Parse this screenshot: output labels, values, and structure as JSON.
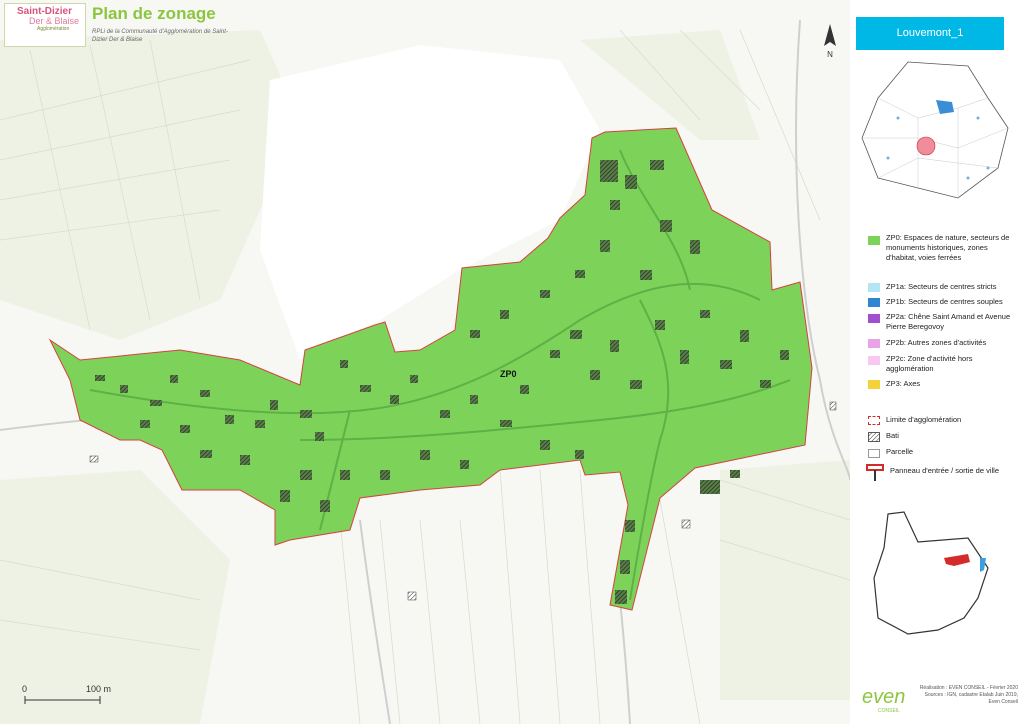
{
  "header": {
    "logo_line1": "Saint-Dizier",
    "logo_line2": "Der & Blaise",
    "logo_line3": "Agglomération",
    "title": "Plan de zonage",
    "subtitle": "RPLi de la Communauté d'Agglomération de Saint-Dizier Der & Blaise"
  },
  "map": {
    "zone_label": "ZP0",
    "north_label": "N"
  },
  "panel": {
    "commune": "Louvemont_1"
  },
  "legend": {
    "items": [
      {
        "label": "ZP0: Espaces de nature, secteurs de monuments historiques, zones d'habitat, voies ferrées",
        "color": "#7dd35a"
      },
      {
        "label": "ZP1a: Secteurs de centres stricts",
        "color": "#b3e6f5"
      },
      {
        "label": "ZP1b: Secteurs de centres souples",
        "color": "#2e86d1"
      },
      {
        "label": "ZP2a: Chêne Saint Amand et Avenue Pierre Beregovoy",
        "color": "#a14fd0"
      },
      {
        "label": "ZP2b: Autres zones d'activités",
        "color": "#e9a3e8"
      },
      {
        "label": "ZP2c: Zone d'activité hors agglomération",
        "color": "#f7c9f0"
      },
      {
        "label": "ZP3: Axes",
        "color": "#f5d23a"
      }
    ],
    "symbols": [
      {
        "label": "Limite d'agglomération",
        "icon": "dashed-red-rect"
      },
      {
        "label": "Bati",
        "icon": "hatched-rect"
      },
      {
        "label": "Parcelle",
        "icon": "white-rect"
      },
      {
        "label": "Panneau d'entrée / sortie de ville",
        "icon": "red-sign",
        "color": "#d42a2a"
      }
    ]
  },
  "scale": {
    "start": "0",
    "end": "100 m"
  },
  "footer": {
    "credits_1": "Réalisation : EVEN CONSEIL - Février 2020",
    "credits_2": "Sources : IGN, cadastre Etalab Juin 2019,",
    "credits_3": "Even Conseil",
    "logo": "even",
    "logo_sub": "CONSEIL"
  }
}
